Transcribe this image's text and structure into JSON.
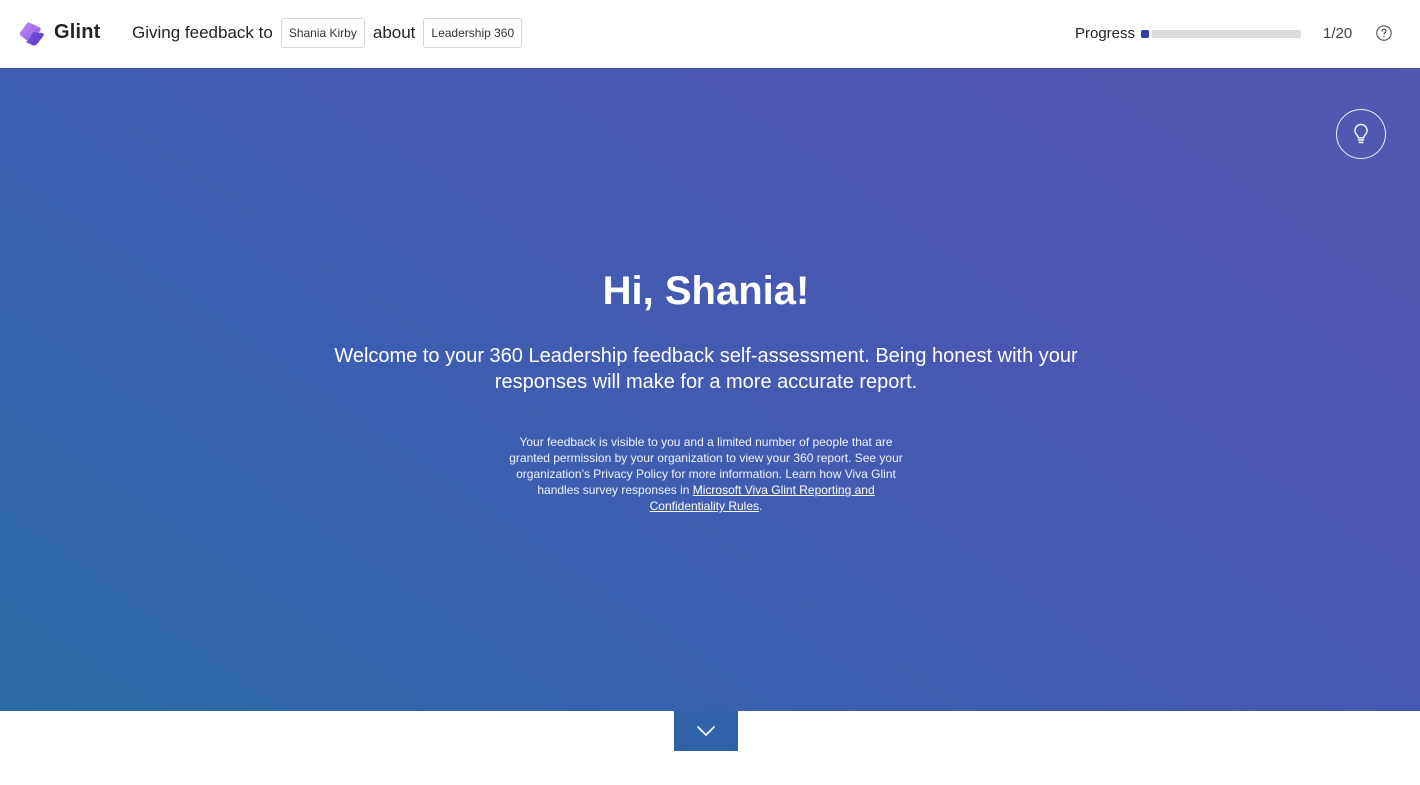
{
  "header": {
    "brand": "Glint",
    "context_prefix": "Giving feedback to",
    "subject_name": "Shania Kirby",
    "context_middle": "about",
    "survey_name": "Leadership 360",
    "progress_label": "Progress",
    "progress_current": 1,
    "progress_total": 20,
    "progress_text": "1/20",
    "help_icon": "question-circle-icon"
  },
  "hero": {
    "tip_icon": "lightbulb-icon",
    "greeting": "Hi, Shania!",
    "welcome": "Welcome to your 360 Leadership feedback self-assessment. Being honest with your responses will make for a more accurate report.",
    "privacy_text": "Your feedback is visible to you and a limited number of people that are granted permission by your organization to view your 360 report. See your organization’s Privacy Policy for more information. Learn how Viva Glint handles survey responses in ",
    "privacy_link": "Microsoft Viva Glint Reporting and Confidentiality Rules",
    "privacy_end": "."
  },
  "scroll_button": {
    "icon": "chevron-down-icon"
  },
  "colors": {
    "progress_fill": "#2f3ea8",
    "progress_track": "#dcdcdc",
    "hero_gradient_start": "#2b6ba6",
    "hero_gradient_end": "#5557b1",
    "logo_primary": "#8b5cf6"
  }
}
